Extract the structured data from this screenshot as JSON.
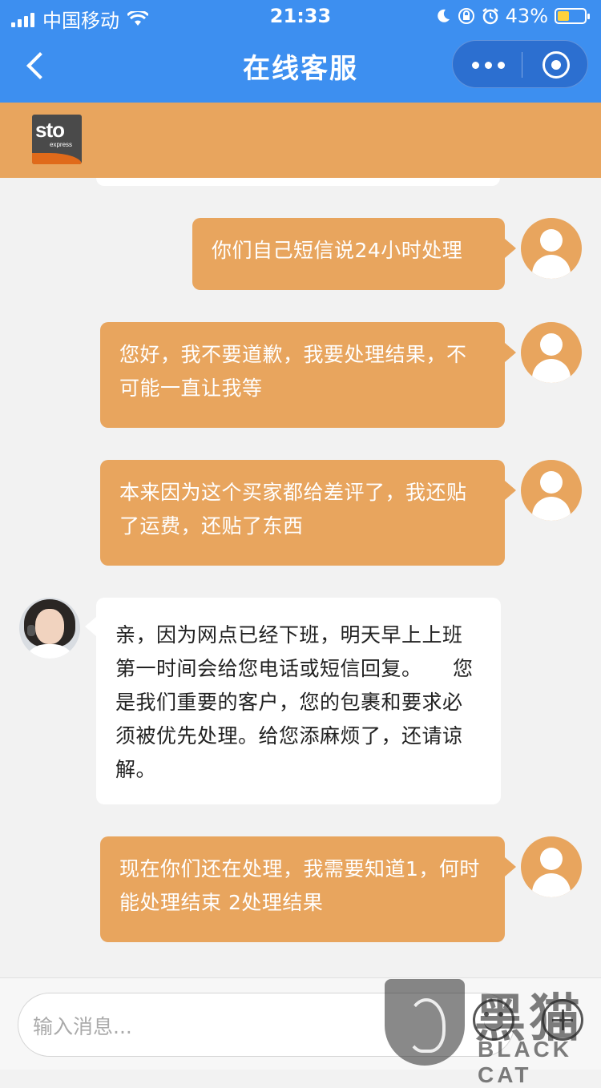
{
  "status_bar": {
    "carrier": "中国移动",
    "time": "21:33",
    "battery": "43%",
    "icons": [
      "signal-icon",
      "wifi-icon",
      "moon-icon",
      "orientation-lock-icon",
      "alarm-icon",
      "battery-icon"
    ]
  },
  "nav": {
    "title": "在线客服",
    "back_icon": "chevron-left-icon",
    "more_icon": "more-dots-icon",
    "close_icon": "target-icon"
  },
  "brand": {
    "logo_text": "sto",
    "logo_subtext": "express"
  },
  "messages": [
    {
      "sender": "user",
      "text": "你们自己短信说24小时处理"
    },
    {
      "sender": "user",
      "text": "您好，我不要道歉，我要处理结果，不可能一直让我等"
    },
    {
      "sender": "user",
      "text": "本来因为这个买家都给差评了，我还贴了运费，还贴了东西"
    },
    {
      "sender": "agent",
      "text": "亲，因为网点已经下班，明天早上上班第一时间会给您电话或短信回复。　　您是我们重要的客户，您的包裹和要求必须被优先处理。给您添麻烦了，还请谅解。"
    },
    {
      "sender": "user",
      "text": "现在你们还在处理，我需要知道1，何时能处理结束 2处理结果"
    }
  ],
  "input": {
    "placeholder": "输入消息..."
  },
  "watermark": {
    "cn": "黑猫",
    "en": "BLACK CAT"
  },
  "colors": {
    "nav_blue": "#3d8ff0",
    "bubble_orange": "#e8a55e",
    "chat_bg": "#f2f2f2"
  }
}
